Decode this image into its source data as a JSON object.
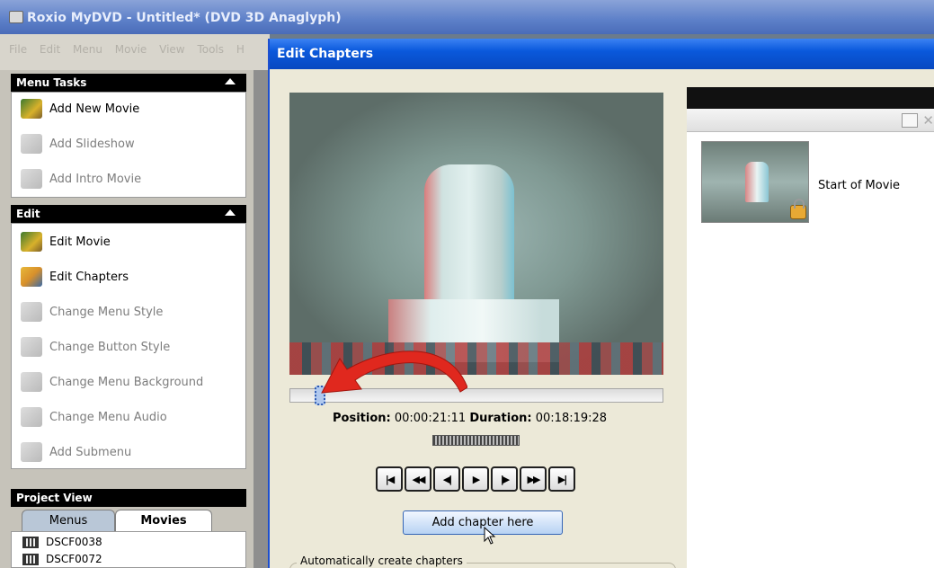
{
  "app": {
    "title": "Roxio MyDVD - Untitled* (DVD 3D Anaglyph)",
    "menu": [
      "File",
      "Edit",
      "Menu",
      "Movie",
      "View",
      "Tools",
      "H"
    ]
  },
  "menu_tasks": {
    "header": "Menu Tasks",
    "items": [
      {
        "label": "Add New Movie",
        "icon": "film-add-icon",
        "enabled": true
      },
      {
        "label": "Add Slideshow",
        "icon": "slideshow-add-icon",
        "enabled": false
      },
      {
        "label": "Add Intro Movie",
        "icon": "intro-movie-icon",
        "enabled": false
      }
    ]
  },
  "edit": {
    "header": "Edit",
    "items": [
      {
        "label": "Edit Movie",
        "icon": "edit-movie-icon",
        "enabled": true
      },
      {
        "label": "Edit Chapters",
        "icon": "edit-chapters-icon",
        "enabled": true
      },
      {
        "label": "Change Menu Style",
        "icon": "menu-style-icon",
        "enabled": false
      },
      {
        "label": "Change Button Style",
        "icon": "button-style-icon",
        "enabled": false
      },
      {
        "label": "Change Menu Background",
        "icon": "menu-background-icon",
        "enabled": false
      },
      {
        "label": "Change Menu Audio",
        "icon": "menu-audio-icon",
        "enabled": false
      },
      {
        "label": "Add Submenu",
        "icon": "submenu-icon",
        "enabled": false
      }
    ]
  },
  "project_view": {
    "header": "Project View",
    "tabs": [
      "Menus",
      "Movies"
    ],
    "selected_tab": "Movies",
    "items": [
      "DSCF0038",
      "DSCF0072"
    ]
  },
  "dialog": {
    "title": "Edit Chapters",
    "position_label": "Position:",
    "position_value": "00:00:21:11",
    "duration_label": "Duration:",
    "duration_value": "00:18:19:28",
    "scrub_progress": 0.02,
    "controls": [
      "go-to-start",
      "rewind",
      "step-back",
      "play",
      "step-forward",
      "fast-forward",
      "go-to-end"
    ],
    "control_glyphs": [
      "|◀",
      "◀◀",
      "◀|",
      "▶",
      "|▶",
      "▶▶",
      "▶|"
    ],
    "add_chapter_label": "Add chapter here",
    "auto_legend": "Automatically create chapters",
    "chapters": [
      {
        "label": "Start of Movie",
        "locked": true
      }
    ]
  },
  "colors": {
    "title_blue": "#0a59dc",
    "arrow_red": "#e0281e",
    "panel_bg": "#ece9d8"
  }
}
